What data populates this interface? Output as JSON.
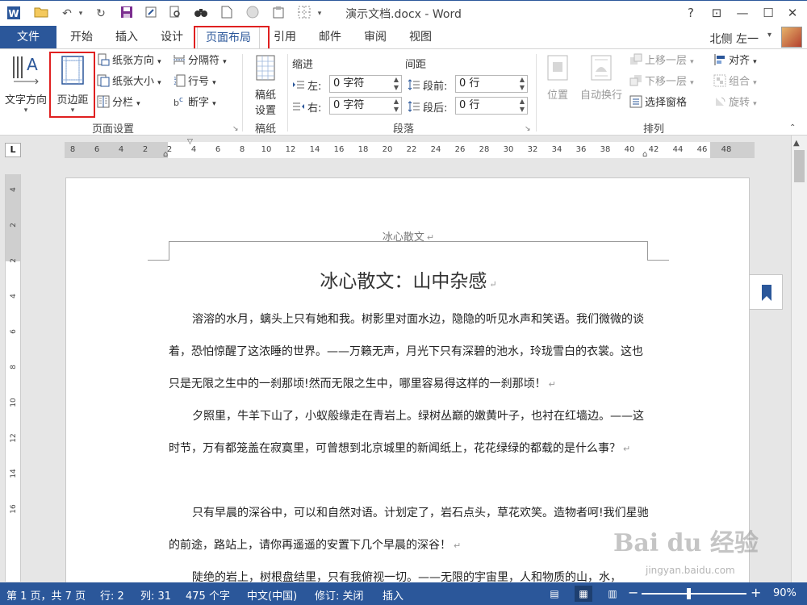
{
  "titlebar": {
    "doc_title": "演示文档.docx - Word",
    "help": "?",
    "ribbon_display": "⊡",
    "minimize": "—",
    "maximize": "☐",
    "close": "✕"
  },
  "tabs": {
    "file": "文件",
    "items": [
      "开始",
      "插入",
      "设计",
      "页面布局",
      "引用",
      "邮件",
      "审阅",
      "视图"
    ],
    "active": "页面布局",
    "user": "北侧 左一"
  },
  "ribbon": {
    "page_setup": {
      "group_label": "页面设置",
      "text_direction": "文字方向",
      "margins": "页边距",
      "orientation": "纸张方向",
      "size": "纸张大小",
      "columns": "分栏",
      "breaks": "分隔符",
      "line_numbers": "行号",
      "hyphenation": "断字"
    },
    "manuscript": {
      "group_label": "稿纸",
      "settings_line1": "稿纸",
      "settings_line2": "设置"
    },
    "paragraph": {
      "group_label": "段落",
      "indent_header": "缩进",
      "spacing_header": "间距",
      "left_label": "左:",
      "left_value": "0 字符",
      "right_label": "右:",
      "right_value": "0 字符",
      "before_label": "段前:",
      "before_value": "0 行",
      "after_label": "段后:",
      "after_value": "0 行"
    },
    "arrange": {
      "group_label": "排列",
      "position": "位置",
      "wrap_text": "自动换行",
      "bring_forward": "上移一层",
      "send_backward": "下移一层",
      "selection_pane": "选择窗格",
      "align": "对齐",
      "group": "组合",
      "rotate": "旋转"
    }
  },
  "ruler": {
    "corner": "L",
    "h_labels": [
      "8",
      "6",
      "4",
      "2",
      "2",
      "4",
      "6",
      "8",
      "10",
      "12",
      "14",
      "16",
      "18",
      "20",
      "22",
      "24",
      "26",
      "28",
      "30",
      "32",
      "34",
      "36",
      "38",
      "40",
      "42",
      "44",
      "46",
      "48"
    ],
    "v_labels": [
      "4",
      "2",
      "2",
      "4",
      "6",
      "8",
      "10",
      "12",
      "14",
      "16"
    ]
  },
  "document": {
    "header": "冰心散文",
    "title": "冰心散文：山中杂感",
    "paragraphs": [
      "溶溶的水月，螭头上只有她和我。树影里对面水边，隐隐的听见水声和笑语。我们微微的谈着，恐怕惊醒了这浓睡的世界。——万籁无声，月光下只有深碧的池水，玲珑雪白的衣裳。这也只是无限之生中的一刹那顷!然而无限之生中，哪里容易得这样的一刹那顷！",
      "夕照里，牛羊下山了，小蚁般缘走在青岩上。绿树丛巅的嫩黄叶子，也衬在红墙边。——这时节，万有都笼盖在寂寞里，可曾想到北京城里的新闻纸上，花花绿绿的都载的是什么事？",
      "只有早晨的深谷中，可以和自然对语。计划定了，岩石点头，草花欢笑。造物者呵!我们星驰的前途，路站上，请你再遥遥的安置下几个早晨的深谷！",
      "陡绝的岩上，树根盘结里，只有我俯视一切。——无限的宇宙里，人和物质的山，水，"
    ],
    "para_mark": "↵"
  },
  "statusbar": {
    "page": "第 1 页，共 7 页",
    "line": "行: 2",
    "column": "列: 31",
    "words": "475 个字",
    "language": "中文(中国)",
    "track_changes": "修订: 关闭",
    "insert_mode": "插入",
    "zoom_minus": "−",
    "zoom_plus": "+",
    "zoom_percent": "90%",
    "zoom_level": 0.9
  },
  "watermark": {
    "text": "Bai du 经验",
    "url": "jingyan.baidu.com"
  },
  "colors": {
    "accent": "#2b579a",
    "highlight_box": "#e02020"
  }
}
